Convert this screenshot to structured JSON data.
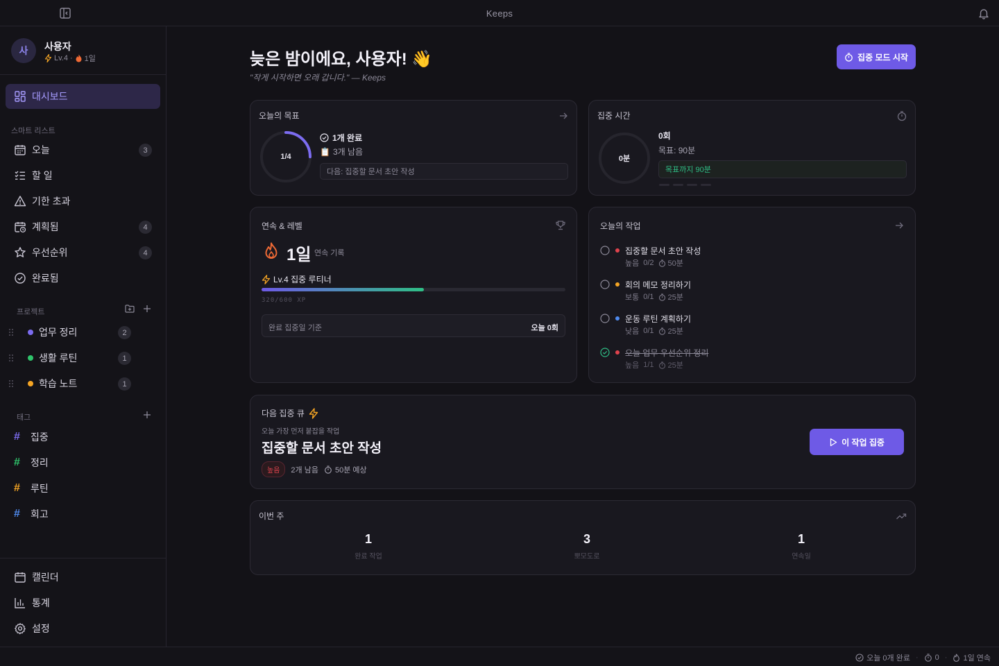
{
  "app": {
    "title": "Keeps"
  },
  "user": {
    "avatar_initial": "사",
    "name": "사용자",
    "level": "Lv.4",
    "dot": "·",
    "streak": "1일"
  },
  "nav": {
    "dashboard": "대시보드",
    "smart_list_label": "스마트 리스트",
    "smart": [
      {
        "label": "오늘",
        "count": "3",
        "icon": "calendar-icon"
      },
      {
        "label": "할 일",
        "count": "",
        "icon": "list-check-icon"
      },
      {
        "label": "기한 초과",
        "count": "",
        "icon": "warning-icon"
      },
      {
        "label": "계획됨",
        "count": "4",
        "icon": "calendar-clock-icon"
      },
      {
        "label": "우선순위",
        "count": "4",
        "icon": "star-icon"
      },
      {
        "label": "완료됨",
        "count": "",
        "icon": "check-circle-icon"
      }
    ],
    "projects_label": "프로젝트",
    "projects": [
      {
        "label": "업무 정리",
        "count": "2",
        "color": "#7c6cf0"
      },
      {
        "label": "생활 루틴",
        "count": "1",
        "color": "#2fc46b"
      },
      {
        "label": "학습 노트",
        "count": "1",
        "color": "#f5a524"
      }
    ],
    "tags_label": "태그",
    "tags": [
      {
        "label": "집중",
        "color": "#7c6cf0"
      },
      {
        "label": "정리",
        "color": "#2fc46b"
      },
      {
        "label": "루틴",
        "color": "#f5a524"
      },
      {
        "label": "회고",
        "color": "#4f8bf0"
      }
    ],
    "bottom": [
      {
        "label": "캘린더",
        "icon": "calendar-icon"
      },
      {
        "label": "통계",
        "icon": "bar-chart-icon"
      },
      {
        "label": "설정",
        "icon": "gear-icon"
      }
    ]
  },
  "header": {
    "greeting": "늦은 밤이에요, 사용자! 👋",
    "quote": "\"작게 시작하면 오래 갑니다.\" — Keeps",
    "focus_button": "집중 모드 시작"
  },
  "goal_card": {
    "title": "오늘의 목표",
    "ring_label": "1/4",
    "progress": 0.25,
    "done": "1개 완료",
    "remaining_icon": "📋",
    "remaining": "3개 남음",
    "next": "다음: 집중할 문서 초안 작성"
  },
  "focus_card": {
    "title": "집중 시간",
    "ring_label": "0분",
    "sessions": "0회",
    "target": "목표: 90분",
    "to_goal": "목표까지 90분"
  },
  "streak_card": {
    "title": "연속 & 레벨",
    "days": "1일",
    "days_caption": "연속 기록",
    "level_title": "Lv.4 집중 루티너",
    "xp": "320/600 XP",
    "xp_progress": 0.5333,
    "basis": "완료 집중일 기준",
    "today": "오늘 0회"
  },
  "tasks_card": {
    "title": "오늘의 작업",
    "tasks": [
      {
        "name": "집중할 문서 초안 작성",
        "priority": "높음",
        "priority_color": "#e0434d",
        "progress": "0/2",
        "time": "50분",
        "done": false
      },
      {
        "name": "회의 메모 정리하기",
        "priority": "보통",
        "priority_color": "#f5a524",
        "progress": "0/1",
        "time": "25분",
        "done": false
      },
      {
        "name": "운동 루틴 계획하기",
        "priority": "낮음",
        "priority_color": "#4f8bf0",
        "progress": "0/1",
        "time": "25분",
        "done": false
      },
      {
        "name": "오늘 업무 우선순위 정리",
        "priority": "높음",
        "priority_color": "#e0434d",
        "progress": "1/1",
        "time": "25분",
        "done": true
      }
    ]
  },
  "queue_card": {
    "title": "다음 집중 큐",
    "subtitle": "오늘 가장 먼저 붙잡을 작업",
    "task": "집중할 문서 초안 작성",
    "priority": "높음",
    "remaining": "2개 남음",
    "estimate": "50분 예상",
    "button": "이 작업 집중"
  },
  "week_card": {
    "title": "이번 주",
    "stats": [
      {
        "value": "1",
        "label": "완료 작업"
      },
      {
        "value": "3",
        "label": "뽀모도로"
      },
      {
        "value": "1",
        "label": "연속일"
      }
    ]
  },
  "statusbar": {
    "completed": "오늘 0개 완료",
    "focus": "0",
    "streak": "1일 연속"
  },
  "colors": {
    "accent": "#6e5ae6",
    "bg": "#131217",
    "card": "#19181f",
    "flame": "#f06a35",
    "xp_start": "#6e5ae6",
    "xp_end": "#2fbf86"
  }
}
